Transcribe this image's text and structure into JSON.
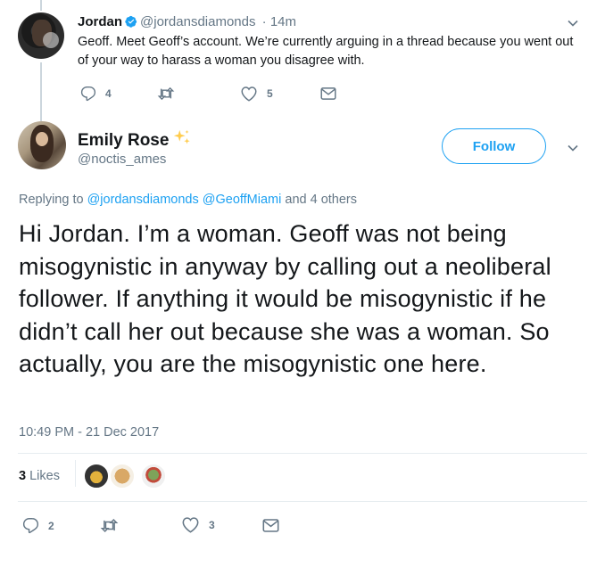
{
  "parent_tweet": {
    "name": "Jordan",
    "handle": "@jordansdiamonds",
    "time": "· 14m",
    "text": "Geoff. Meet Geoff’s account. We’re currently arguing in a thread because you went out of your way to harass a woman you disagree with.",
    "actions": {
      "reply_count": "4",
      "retweet_count": "",
      "like_count": "5"
    }
  },
  "main_tweet": {
    "name": "Emily Rose",
    "handle": "@noctis_ames",
    "follow_label": "Follow",
    "replying_prefix": "Replying to",
    "replying_mention_1": "@jordansdiamonds",
    "replying_mention_2": "@GeoffMiami",
    "replying_suffix": "and 4 others",
    "text": "Hi Jordan. I’m a woman. Geoff was not being misogynistic in anyway by calling out a neoliberal follower. If anything it would be misogynistic if he didn’t call her out because she was a woman. So actually, you are the misogynistic one here.",
    "timestamp": "10:49 PM - 21 Dec 2017",
    "likes": {
      "count": "3",
      "label": "Likes"
    },
    "actions": {
      "reply_count": "2",
      "retweet_count": "",
      "like_count": "3"
    }
  },
  "colors": {
    "accent": "#1da1f2",
    "secondary_text": "#657786",
    "primary_text": "#14171a",
    "divider": "#e6ecf0"
  },
  "icons": [
    "verified-icon",
    "caret-down-icon",
    "reply-icon",
    "retweet-icon",
    "heart-icon",
    "envelope-icon",
    "sparkle-icon"
  ]
}
